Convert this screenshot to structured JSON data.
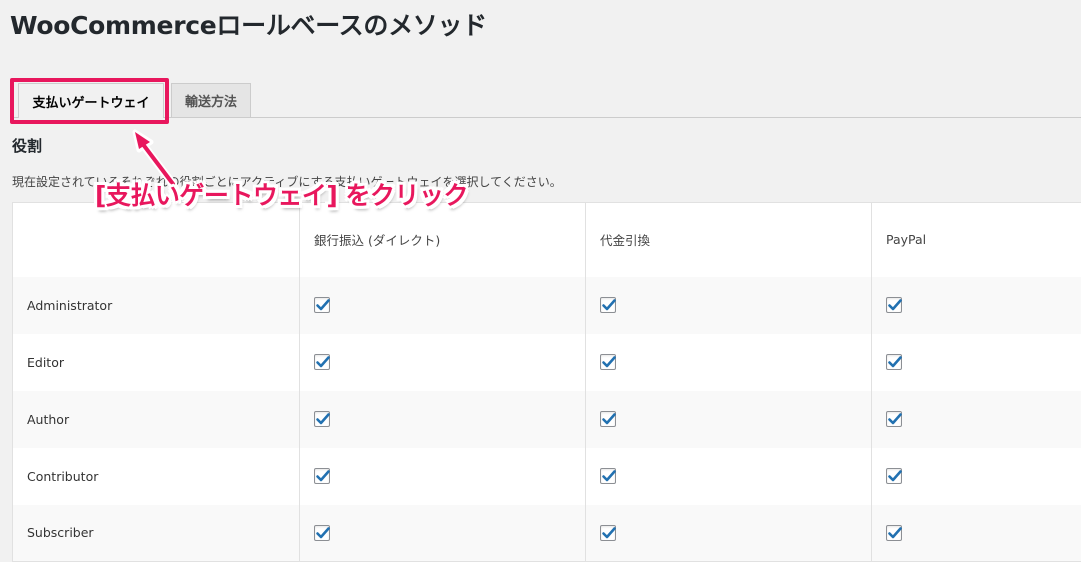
{
  "page": {
    "title": "WooCommerceロールベースのメソッド"
  },
  "tabs": [
    {
      "label": "支払いゲートウェイ",
      "active": true
    },
    {
      "label": "輸送方法",
      "active": false
    }
  ],
  "section": {
    "heading": "役割",
    "description": "現在設定されているそれぞれの役割ごとにアクティブにする支払いゲートウェイを選択してください。"
  },
  "table": {
    "columns": [
      "",
      "銀行振込 (ダイレクト)",
      "代金引換",
      "PayPal"
    ],
    "rows": [
      {
        "role": "Administrator",
        "checks": [
          true,
          true,
          true
        ]
      },
      {
        "role": "Editor",
        "checks": [
          true,
          true,
          true
        ]
      },
      {
        "role": "Author",
        "checks": [
          true,
          true,
          true
        ]
      },
      {
        "role": "Contributor",
        "checks": [
          true,
          true,
          true
        ]
      },
      {
        "role": "Subscriber",
        "checks": [
          true,
          true,
          true
        ]
      }
    ]
  },
  "annotation": {
    "text": "[支払いゲートウェイ] をクリック",
    "color": "#e8175d"
  },
  "colors": {
    "accent": "#e8175d",
    "checkbox_tick": "#2271b1"
  }
}
